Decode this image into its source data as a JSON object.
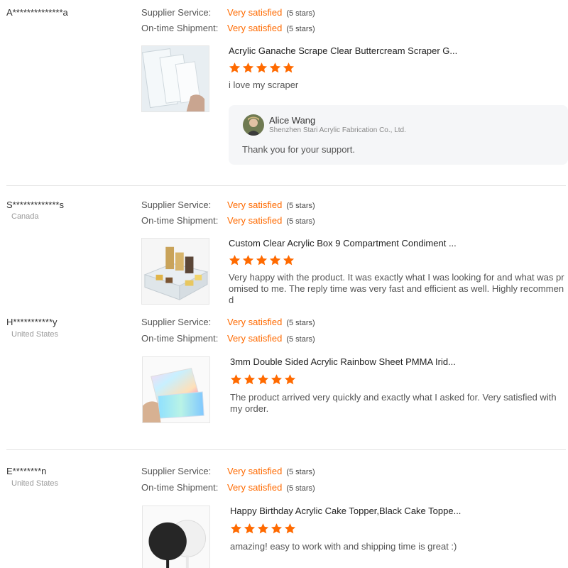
{
  "colors": {
    "accent": "#ff6a00",
    "star": "#ff6a00",
    "divider": "#e3e3e3",
    "reply_bg": "#f5f6f8"
  },
  "labels": {
    "supplier_service": "Supplier Service:",
    "on_time_shipment": "On-time Shipment:"
  },
  "reviews": [
    {
      "buyer": "A**************a",
      "country": "",
      "supplier_service": "Very satisfied",
      "supplier_service_stars": "(5 stars)",
      "shipment": "Very satisfied",
      "shipment_stars": "(5 stars)",
      "product_title": "Acrylic Ganache Scrape Clear Buttercream Scraper G...",
      "rating": 5,
      "comment": "i love my scraper",
      "reply": {
        "name": "Alice Wang",
        "company": "Shenzhen Stari Acrylic Fabrication Co., Ltd.",
        "text": "Thank you for your support."
      }
    },
    {
      "buyer": "S*************s",
      "country": "Canada",
      "supplier_service": "Very satisfied",
      "supplier_service_stars": "(5 stars)",
      "shipment": "Very satisfied",
      "shipment_stars": "(5 stars)",
      "product_title": "Custom Clear Acrylic Box 9 Compartment Condiment ...",
      "rating": 5,
      "comment": "Very happy with the product. It was exactly what I was looking for and what was promised to me. The reply time was very fast and efficient as well. Highly recommend"
    },
    {
      "buyer": "H***********y",
      "country": "United States",
      "supplier_service": "Very satisfied",
      "supplier_service_stars": "(5 stars)",
      "shipment": "Very satisfied",
      "shipment_stars": "(5 stars)",
      "product_title": "3mm Double Sided Acrylic Rainbow Sheet PMMA Irid...",
      "rating": 5,
      "comment": "The product arrived very quickly and exactly what I asked for. Very satisfied with my order."
    },
    {
      "buyer": "E********n",
      "country": "United States",
      "supplier_service": "Very satisfied",
      "supplier_service_stars": "(5 stars)",
      "shipment": "Very satisfied",
      "shipment_stars": "(5 stars)",
      "product_title": "Happy Birthday Acrylic Cake Topper,Black Cake Toppe...",
      "rating": 5,
      "comment": "amazing! easy to work with and shipping time is great :)"
    }
  ]
}
